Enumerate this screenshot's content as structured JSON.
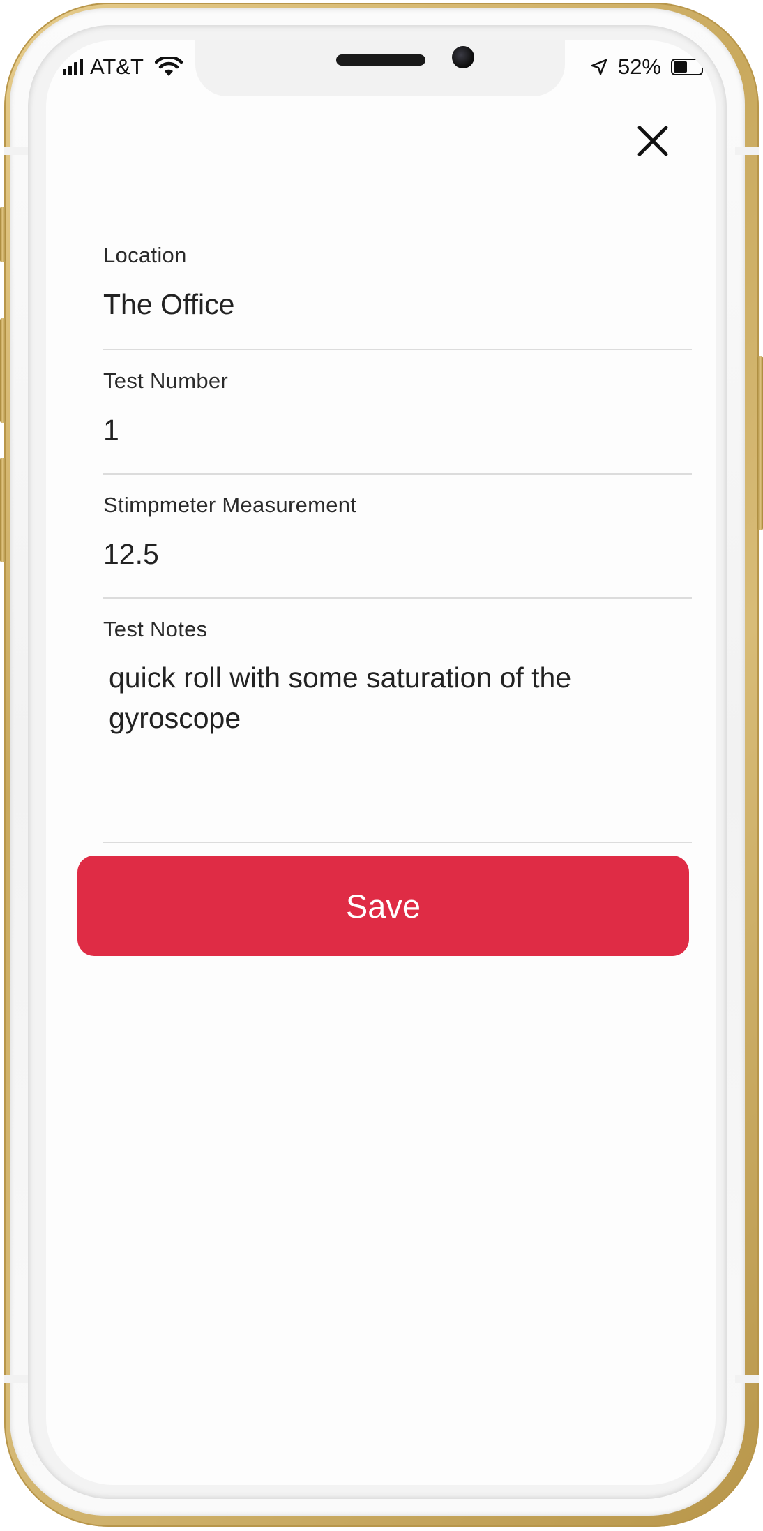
{
  "status_bar": {
    "carrier": "AT&T",
    "battery_percent": "52%",
    "battery_level": 0.52
  },
  "form": {
    "location": {
      "label": "Location",
      "value": "The Office"
    },
    "test_number": {
      "label": "Test Number",
      "value": "1"
    },
    "stimpmeter": {
      "label": "Stimpmeter Measurement",
      "value": "12.5"
    },
    "test_notes": {
      "label": "Test Notes",
      "value": "quick roll with some saturation of the gyroscope"
    }
  },
  "actions": {
    "save_label": "Save"
  },
  "icons": {
    "close": "close-icon",
    "wifi": "wifi-icon",
    "signal": "signal-icon",
    "location": "location-arrow-icon",
    "battery": "battery-icon"
  },
  "colors": {
    "save_button": "#df2c45",
    "frame_gold": "#c9a95e",
    "text": "#222222",
    "divider": "#dcdcdc"
  }
}
